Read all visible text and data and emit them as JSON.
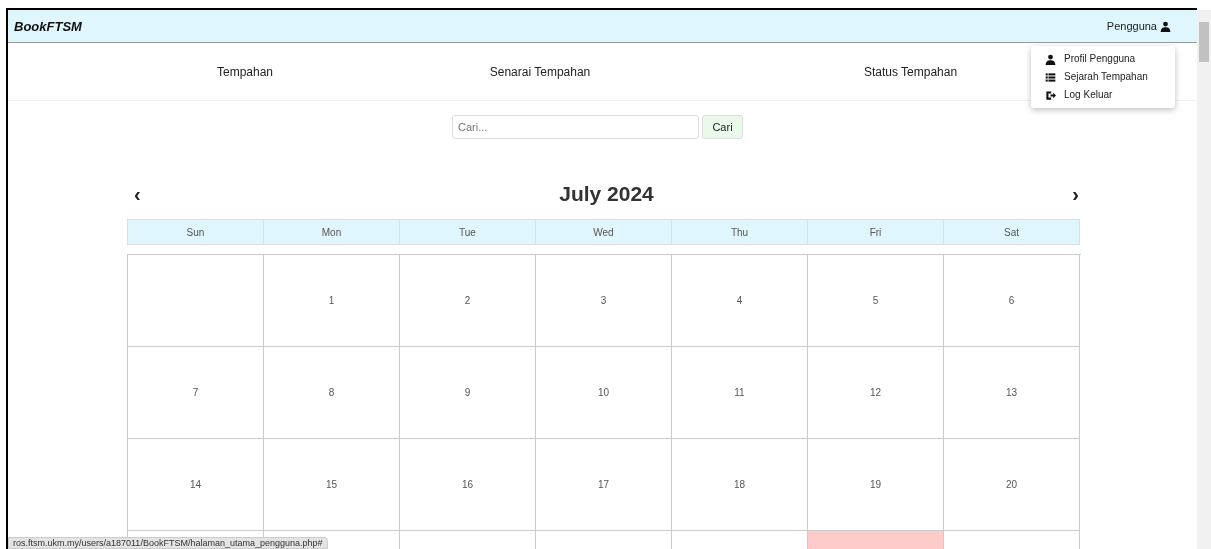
{
  "navbar": {
    "brand": "BookFTSM",
    "user_menu": "Pengguna"
  },
  "dropdown": {
    "items": [
      {
        "kind": "user",
        "label": "Profil Pengguna"
      },
      {
        "kind": "list",
        "label": "Sejarah Tempahan"
      },
      {
        "kind": "logout",
        "label": "Log Keluar"
      }
    ]
  },
  "nav_links": [
    "Tempahan",
    "Senarai Tempahan",
    "Status Tempahan"
  ],
  "search": {
    "placeholder": "Cari...",
    "button": "Cari"
  },
  "calendar": {
    "title": "July 2024",
    "prev": "‹",
    "next": "›",
    "weekdays": [
      "Sun",
      "Mon",
      "Tue",
      "Wed",
      "Thu",
      "Fri",
      "Sat"
    ],
    "weeks": [
      [
        {
          "highlighted": false
        },
        {
          "day": "1",
          "highlighted": false
        },
        {
          "day": "2",
          "highlighted": false
        },
        {
          "day": "3",
          "highlighted": false
        },
        {
          "day": "4",
          "highlighted": false
        },
        {
          "day": "5",
          "highlighted": false
        },
        {
          "day": "6",
          "highlighted": false
        }
      ],
      [
        {
          "day": "7",
          "highlighted": false
        },
        {
          "day": "8",
          "highlighted": false
        },
        {
          "day": "9",
          "highlighted": false
        },
        {
          "day": "10",
          "highlighted": false
        },
        {
          "day": "11",
          "highlighted": false
        },
        {
          "day": "12",
          "highlighted": false
        },
        {
          "day": "13",
          "highlighted": false
        }
      ],
      [
        {
          "day": "14",
          "highlighted": false
        },
        {
          "day": "15",
          "highlighted": false
        },
        {
          "day": "16",
          "highlighted": false
        },
        {
          "day": "17",
          "highlighted": false
        },
        {
          "day": "18",
          "highlighted": false
        },
        {
          "day": "19",
          "highlighted": false
        },
        {
          "day": "20",
          "highlighted": false
        }
      ],
      [
        {
          "highlighted": false
        },
        {
          "highlighted": false
        },
        {
          "highlighted": false
        },
        {
          "highlighted": false
        },
        {
          "highlighted": false
        },
        {
          "highlighted": true
        },
        {
          "highlighted": false
        }
      ]
    ]
  },
  "status_bar": {
    "url": "ros.ftsm.ukm.my/users/a187011/BookFTSM/halaman_utama_pengguna.php#"
  }
}
